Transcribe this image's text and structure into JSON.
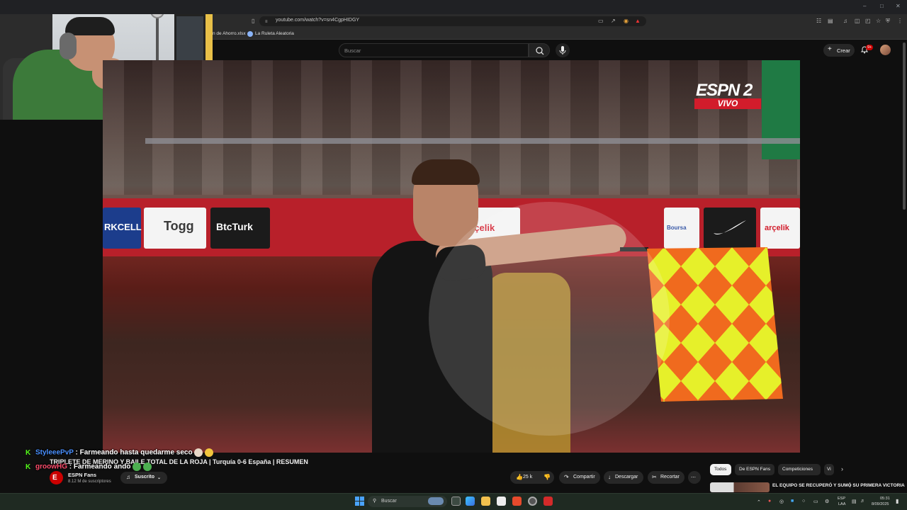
{
  "browser": {
    "url": "youtube.com/watch?v=sn4CgpHIDGY",
    "bookmarks": [
      "n de Ahorro.xlsx",
      "La Ruleta Aleatoria"
    ]
  },
  "yt_header": {
    "search_placeholder": "Buscar",
    "create_label": "Crear",
    "notif_badge": "9+"
  },
  "video": {
    "title": "TRIPLETE DE MERINO Y BAILE TOTAL DE LA ROJA | Turquía 0-6 España | RESUMEN",
    "broadcast_logo": "ESPN 2",
    "live_label": "VIVO",
    "ads": [
      "RKCELL",
      "Togg",
      "BtcTurk",
      "arçelik",
      "Boursa",
      "arçelik"
    ]
  },
  "channel": {
    "name": "ESPN Fans",
    "subscribers": "8.12 M de suscriptores",
    "subscribed_label": "Suscrito"
  },
  "actions": {
    "likes": "25 k",
    "share": "Compartir",
    "download": "Descargar",
    "clip": "Recortar"
  },
  "chat": [
    {
      "user": "StyleeePvP",
      "message": ": Farmeando hasta quedarme seco",
      "color": "#4a90ff"
    },
    {
      "user": "groowHG",
      "message": ": Farmeando ando",
      "color": "#ff4d6d"
    }
  ],
  "sidebar": {
    "chips": [
      "Todos",
      "De ESPN Fans",
      "Competiciones",
      "Vi"
    ],
    "rec_title": "EL EQUIPO SE RECUPERÓ Y SUMÓ SU PRIMERA VICTORIA"
  },
  "taskbar": {
    "search_placeholder": "Buscar",
    "lang": "ESP",
    "lang_sub": "LAA",
    "time": "05:31",
    "date": "8/09/2025"
  }
}
